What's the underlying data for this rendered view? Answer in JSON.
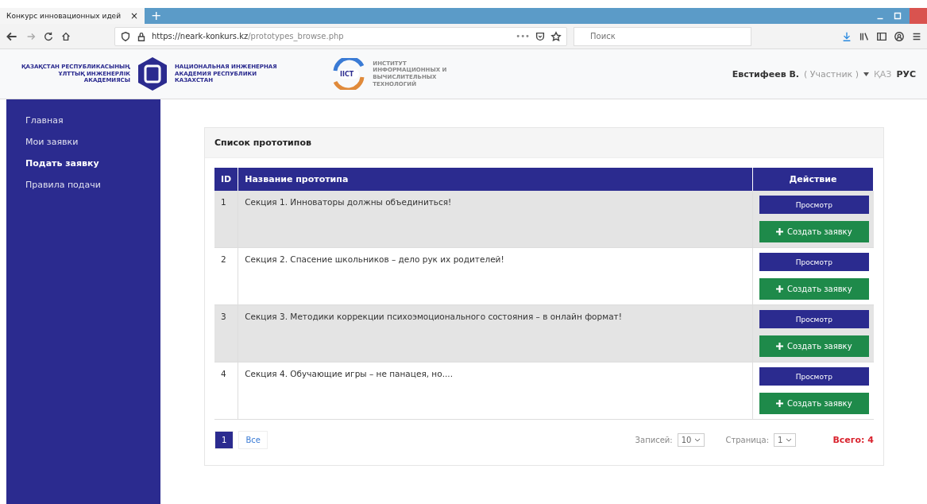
{
  "browser": {
    "tab_title": "Конкурс инновационных идей",
    "tab_close": "×",
    "new_tab": "+",
    "url_host": "https://neark-konkurs.kz",
    "url_path": "/prototypes_browse.php",
    "search_placeholder": "Поиск",
    "more": "•••"
  },
  "header": {
    "logo_left_kz": "ҚАЗАҚСТАН РЕСПУБЛИКАСЫНЫҢ ҰЛТТЫҚ ИНЖЕНЕРЛІК АКАДЕМИЯСЫ",
    "logo_left_ru": "НАЦИОНАЛЬНАЯ ИНЖЕНЕРНАЯ АКАДЕМИЯ РЕСПУБЛИКИ КАЗАХСТАН",
    "logo_iict": "IICT",
    "logo_iict_text": "ИНСТИТУТ ИНФОРМАЦИОННЫХ И ВЫЧИСЛИТЕЛЬНЫХ ТЕХНОЛОГИЙ",
    "user_name": "Евстифеев В.",
    "user_role": "( Участник )",
    "languages": [
      {
        "label": "ҚАЗ",
        "selected": false
      },
      {
        "label": "РУС",
        "selected": true
      }
    ]
  },
  "sidebar": {
    "items": [
      {
        "label": "Главная",
        "selected": false
      },
      {
        "label": "Мои заявки",
        "selected": false
      },
      {
        "label": "Подать заявку",
        "selected": true
      },
      {
        "label": "Правила подачи",
        "selected": false
      }
    ]
  },
  "card": {
    "title": "Список прототипов",
    "columns": [
      "ID",
      "Название прототипа",
      "Действие"
    ],
    "rows": [
      {
        "id": "1",
        "name": "Секция 1. Инноваторы должны объединиться!",
        "view": "Просмотр",
        "create": "Создать заявку"
      },
      {
        "id": "2",
        "name": "Секция 2. Спасение школьников – дело рук их родителей!",
        "view": "Просмотр",
        "create": "Создать заявку"
      },
      {
        "id": "3",
        "name": "Секция 3. Методики коррекции психоэмоционального состояния – в онлайн формат!",
        "view": "Просмотр",
        "create": "Создать заявку"
      },
      {
        "id": "4",
        "name": "Секция 4. Обучающие игры – не панацея, но....",
        "view": "Просмотр",
        "create": "Создать заявку"
      }
    ],
    "pages": [
      {
        "label": "1",
        "selected": true
      },
      {
        "label": "Все",
        "selected": false
      }
    ],
    "records_label": "Записей:",
    "records_value": "10",
    "page_label": "Страница:",
    "page_value": "1",
    "total": "Всего: 4"
  }
}
